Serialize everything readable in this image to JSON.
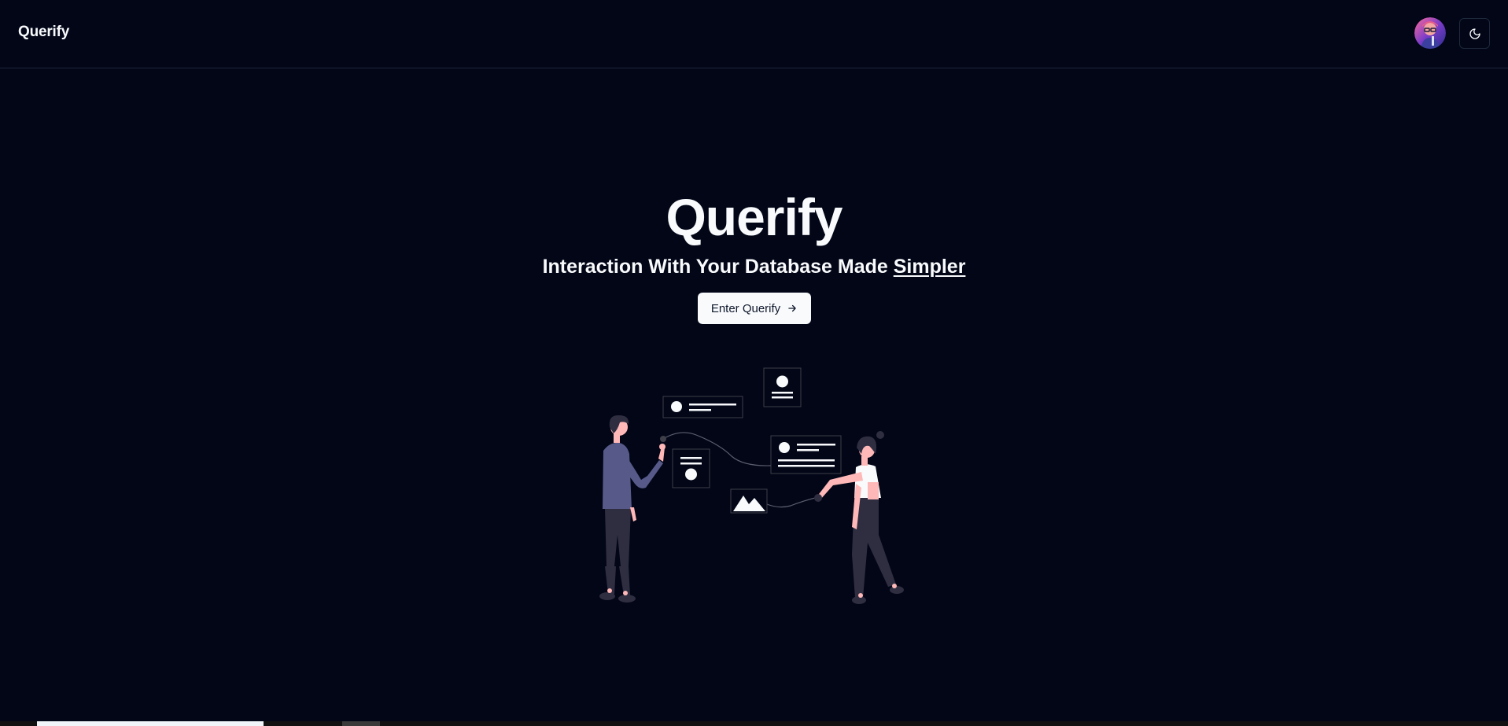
{
  "navbar": {
    "brand": "Querify",
    "avatar_icon": "user-avatar",
    "theme_toggle_icon": "moon-icon"
  },
  "hero": {
    "title": "Querify",
    "subtitle_prefix": "Interaction With Your Database Made ",
    "subtitle_emphasis": "Simpler",
    "cta_label": "Enter Querify",
    "cta_icon": "arrow-right-icon",
    "illustration": "people-sharing-content-illustration"
  },
  "colors": {
    "background": "#020617",
    "text": "#f8fafc",
    "border": "#1e293b",
    "button_bg": "#f8fafc",
    "button_text": "#0f172a",
    "figure_shirt": "#575a89",
    "figure_dark": "#2f2e41",
    "skin": "#ffb8b8"
  }
}
